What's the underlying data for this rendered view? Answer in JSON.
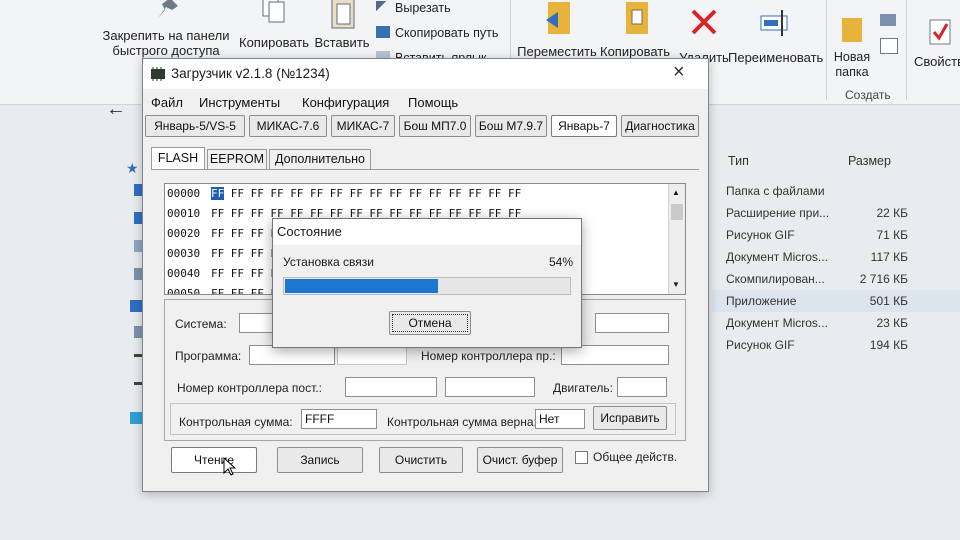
{
  "ribbon": {
    "pin_label": "Закрепить на панели быстрого доступа",
    "copy_label": "Копировать",
    "paste_label": "Вставить",
    "cut_label": "Вырезать",
    "copy_path_label": "Скопировать путь",
    "paste_shortcut_label": "Вставить ярлык",
    "move_to_label": "Переместить в",
    "copy_to_label": "Копировать в",
    "delete_label": "Удалить",
    "rename_label": "Переименовать",
    "new_folder_label": "Новая папка",
    "properties_label": "Свойства",
    "group_create_label": "Создать"
  },
  "file_list": {
    "col_type": "Тип",
    "col_size": "Размер",
    "rows": [
      {
        "type": "Папка с файлами",
        "size": ""
      },
      {
        "type": "Расширение при...",
        "size": "22 КБ"
      },
      {
        "type": "Рисунок GIF",
        "size": "71 КБ"
      },
      {
        "type": "Документ Micros...",
        "size": "117 КБ"
      },
      {
        "type": "Скомпилирован...",
        "size": "2 716 КБ"
      },
      {
        "type": "Приложение",
        "size": "501 КБ"
      },
      {
        "type": "Документ Micros...",
        "size": "23 КБ"
      },
      {
        "type": "Рисунок GIF",
        "size": "194 КБ"
      }
    ]
  },
  "loader": {
    "title": "Загрузчик v2.1.8 (№1234)",
    "close_glyph": "×",
    "menu": [
      "Файл",
      "Инструменты",
      "Конфигурация",
      "Помощь"
    ],
    "ecu_buttons": [
      "Январь-5/VS-5",
      "МИКАС-7.6",
      "МИКАС-7",
      "Бош МП7.0",
      "Бош М7.9.7",
      "Январь-7",
      "Диагностика"
    ],
    "tabs": [
      "FLASH",
      "EEPROM",
      "Дополнительно"
    ],
    "hex": {
      "addresses": [
        "00000",
        "00010",
        "00020",
        "00030",
        "00040",
        "00050"
      ],
      "cell": "FF"
    },
    "fields": {
      "system_label": "Система:",
      "program_label": "Программа:",
      "ecu_number_label": "Номер контроллера пр.:",
      "supplier_number_label": "Номер контроллера пост.:",
      "engine_label": "Двигатель:",
      "checksum_label": "Контрольная сумма:",
      "checksum_value": "FFFF",
      "checksum_ok_label": "Контрольная сумма верна:",
      "checksum_ok_value": "Нет",
      "fix_button": "Исправить"
    },
    "bottom": {
      "read": "Чтение",
      "write": "Запись",
      "clear": "Очистить",
      "clear_buffer": "Очист. буфер",
      "common_action": "Общее действ."
    }
  },
  "status_dialog": {
    "title": "Состояние",
    "message": "Установка связи",
    "percent_text": "54%",
    "progress": 0.54,
    "cancel": "Отмена"
  },
  "colors": {
    "progress_fill": "#1f75d2",
    "hex_selection": "#1d5db8",
    "delete_icon": "#d6262b",
    "folder": "#e8b33c"
  }
}
